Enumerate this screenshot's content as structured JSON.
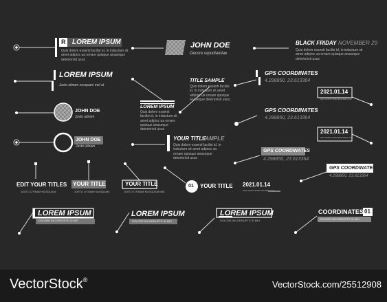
{
  "items": {
    "a": {
      "badge": "R",
      "title": "LOREM IPSUM",
      "body": "Quis dolem essenti facilisi id, in inductum sit amet adipisc ua ornare quisque anaseque deteriorisit usus"
    },
    "b": {
      "title": "JOHN DOE",
      "sub": "Decore repudiandae"
    },
    "c": {
      "title": "BLACK FRIDAY",
      "date": "NOVEMBER 29",
      "body": "Quis dolem essenti facilisi id, in inductum sit amet adipisc ua ornare quisque anaseque deteriorisit usus"
    },
    "d": {
      "title": "LOREM IPSUM",
      "sub": "Justo utinam nusquam mel ut"
    },
    "e": {
      "title": "TITLE SAMPLE",
      "body": "Quis dolem essenti facilisi id, in inductum sit amet adipisc ua ornare quisque anaseque deteriorisit usus"
    },
    "f": {
      "title": "GPS COORDINATES",
      "value": "4.298850, 23.613364"
    },
    "g": {
      "title": "LOREM IPSUM",
      "body": "Quis dolem essenti facilisi id, in inductum sit amet adipisc ua ornare quisque anaseque deteriorisit usus"
    },
    "h": {
      "title": "JOHN DOE",
      "sub": "Justo utinam"
    },
    "i": {
      "date": "2021.01.14",
      "sub": "HAS SCIPIT ENIM DOLORE CCA"
    },
    "j": {
      "title": "GPS COORDINATES",
      "value": "4.298850, 23.613364"
    },
    "k": {
      "title": "JOHN DOE",
      "sub": "Justo utinam"
    },
    "l": {
      "title": "YOUR TITLE",
      "title2": "SAMPLE",
      "body": "Quis dolem essenti facilisi id, in inductum sit amet adipisc ua ornare quisque anaseque deteriorisit usus"
    },
    "m": {
      "date": "2021.01.14",
      "sub": "HAS SCIPIT ENIM DOLORE CCA"
    },
    "n": {
      "title": "GPS COORDINATES",
      "value": "4.298850, 23.613364"
    },
    "o": {
      "title": "GPS COORDINATES",
      "value": "4.298850, 23.613364"
    },
    "p": {
      "title": "EDIT YOUR TITLES",
      "sub": "JUSTO UTINAM NUSQUAM"
    },
    "q": {
      "title": "YOUR TITLE",
      "sub": "JUSTO UTINAM NUSQUAM"
    },
    "r": {
      "title": "YOUR TITLE",
      "sub": "JUSTO UTINAM NUSQUAM MEL"
    },
    "s": {
      "num": "01",
      "title": "YOUR TITLE"
    },
    "t": {
      "date": "2021.01.14",
      "sub": "HAS SCIPIT ENIM DOLORE CCA"
    },
    "u": {
      "title": "LOREM IPSUM",
      "sub": "DOLORE INCORRUPTE ID MEI"
    },
    "v": {
      "title": "LOREM IPSUM",
      "sub": "DOLORE INCORRUPTE ID MEI"
    },
    "w": {
      "title": "LOREM IPSUM",
      "sub": "DOLORE INCORRUPTE ID MEI"
    },
    "x": {
      "title": "COORDINATES",
      "num": "01",
      "sub": "DOLORE INCORRUPTE ID MEI"
    }
  },
  "watermark": {
    "brand": "VectorStock",
    "reg": "®",
    "url": "VectorStock.com/25512908"
  }
}
